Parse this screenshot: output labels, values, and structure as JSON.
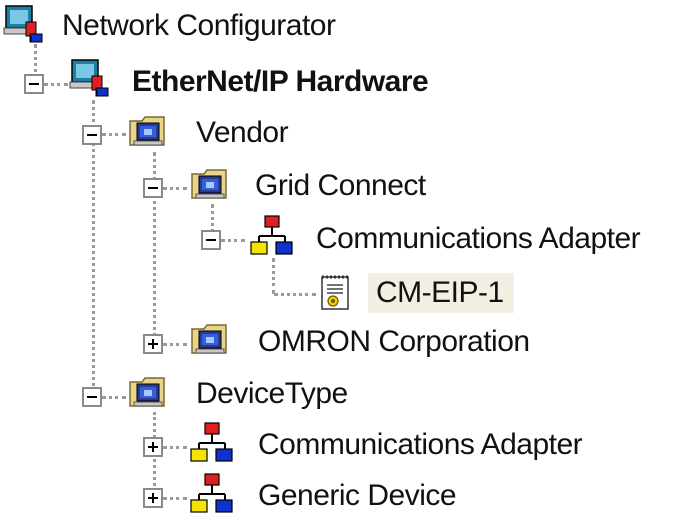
{
  "tree": {
    "root": {
      "label": "Network Configurator",
      "icon": "network-configurator-icon"
    },
    "hardware": {
      "label": "EtherNet/IP Hardware",
      "icon": "network-configurator-icon"
    },
    "vendor": {
      "label": "Vendor",
      "icon": "folder-icon"
    },
    "grid_connect": {
      "label": "Grid Connect",
      "icon": "folder-icon"
    },
    "grid_comm_adapter": {
      "label": "Communications Adapter",
      "icon": "device-network-icon"
    },
    "cm_eip": {
      "label": "CM-EIP-1",
      "icon": "eds-file-icon",
      "selected": true
    },
    "omron": {
      "label": "OMRON Corporation",
      "icon": "folder-icon"
    },
    "device_type": {
      "label": "DeviceType",
      "icon": "folder-icon"
    },
    "type_comm_adapter": {
      "label": "Communications Adapter",
      "icon": "device-network-icon"
    },
    "generic_device": {
      "label": "Generic Device",
      "icon": "device-network-icon"
    }
  },
  "colors": {
    "selection": "#f2efe3",
    "tree_lines": "#9a9a9a",
    "node_red": "#e02020",
    "node_yellow": "#f4e400",
    "node_blue": "#1030d0",
    "folder": "#e8d48a",
    "monitor": "#1c7fa6"
  }
}
